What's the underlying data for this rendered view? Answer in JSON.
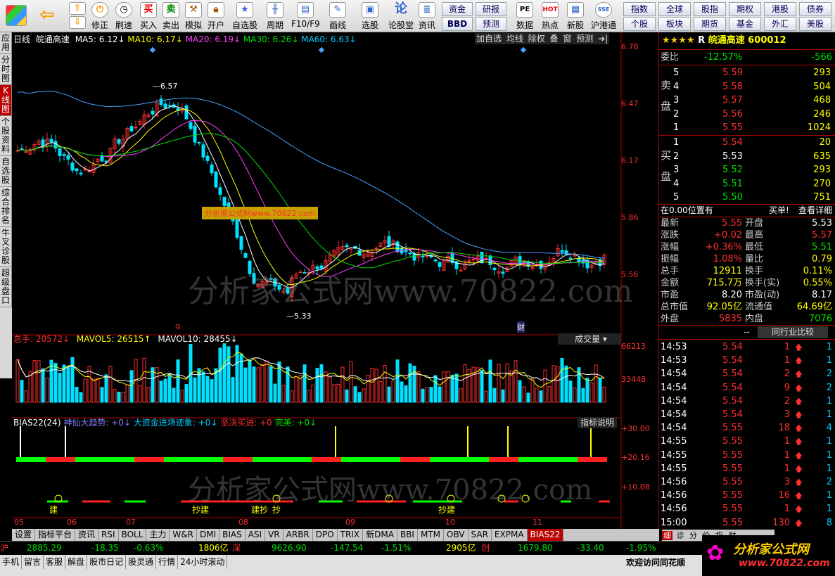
{
  "toolbar": {
    "buttons": [
      "修正",
      "刷速",
      "买入",
      "卖出",
      "模拟",
      "开户",
      "自选股",
      "周期",
      "F10/F9",
      "画线",
      "选股",
      "论股堂",
      "资讯",
      "数据",
      "热点",
      "新股",
      "沪港通"
    ],
    "small1": [
      "资金",
      "BBD"
    ],
    "small2": [
      "研报",
      "预测"
    ],
    "right_top": [
      "指数",
      "全球",
      "股指",
      "期权",
      "港股",
      "债券"
    ],
    "right_bot": [
      "个股",
      "板块",
      "期货",
      "基金",
      "外汇",
      "美股"
    ]
  },
  "left_tabs": [
    "应用",
    "分时图",
    "K线图",
    "个股资料",
    "自选股",
    "综合排名",
    "牛叉诊股",
    "超级盘口"
  ],
  "kline_header": {
    "period": "日线",
    "name": "皖通高速",
    "ma5": "MA5: 6.12↓",
    "ma10": "MA10: 6.17↓",
    "ma20": "MA20: 6.19↓",
    "ma30": "MA30: 6.26↓",
    "ma60": "MA60: 6.63↓",
    "btns": [
      "加自选",
      "均线",
      "除权",
      "叠",
      "窗",
      "预测"
    ]
  },
  "price_axis": [
    "6.78",
    "6.47",
    "6.17",
    "5.86",
    "5.56"
  ],
  "annot": {
    "high": "6.57",
    "low": "5.33",
    "q": "q",
    "cai": "财"
  },
  "vol_header": {
    "a": "总手: 20572↓",
    "b": "MAVOL5: 26515↑",
    "c": "MAVOL10: 28455↓",
    "btn": "成交量"
  },
  "vol_axis": [
    "66213",
    "33448"
  ],
  "bias_header": {
    "a": "BIAS22(24)",
    "b": "神仙大趋势: +0↓",
    "c": "大资金进场迹象: +0↓",
    "d": "坚决买进: +0",
    "e": "完美: +0↓",
    "btn": "指标说明"
  },
  "bias_axis": [
    "+30.00",
    "+20.16",
    "+10.08"
  ],
  "bias_marks": [
    "建",
    "抄建",
    "建抄",
    "抄",
    "抄建"
  ],
  "months": [
    "05",
    "06",
    "07",
    "08",
    "09",
    "10",
    "11"
  ],
  "watermark": "分析家公式网www.70822.com",
  "watermark_small": "分析家公式网www.70822.com",
  "bottom_tabs": [
    "设置",
    "指标平台",
    "资讯",
    "RSI",
    "BOLL",
    "主力",
    "W&R",
    "DMI",
    "BIAS",
    "ASI",
    "VR",
    "ARBR",
    "DPO",
    "TRIX",
    "新DMA",
    "BBI",
    "MTM",
    "OBV",
    "SAR",
    "EXPMA",
    "BIAS22"
  ],
  "stock": {
    "stars": "★★★★",
    "r": "R",
    "name": "皖通高速",
    "code": "600012"
  },
  "weibi": {
    "label": "委比",
    "pct": "-12.57%",
    "val": "-566"
  },
  "sell": [
    [
      "5",
      "5.59",
      "293"
    ],
    [
      "4",
      "5.58",
      "504"
    ],
    [
      "3",
      "5.57",
      "468"
    ],
    [
      "2",
      "5.56",
      "246"
    ],
    [
      "1",
      "5.55",
      "1024"
    ]
  ],
  "buy": [
    [
      "1",
      "5.54",
      "20"
    ],
    [
      "2",
      "5.53",
      "635"
    ],
    [
      "3",
      "5.52",
      "293"
    ],
    [
      "4",
      "5.51",
      "270"
    ],
    [
      "5",
      "5.50",
      "751"
    ]
  ],
  "sell_label": "卖盘",
  "buy_label": "买盘",
  "pos": {
    "a": "在0.00位置有",
    "b": "买单!",
    "c": "查看详细"
  },
  "quote": [
    [
      "最新",
      "5.55",
      "开盘",
      "5.53"
    ],
    [
      "涨跌",
      "+0.02",
      "最高",
      "5.57"
    ],
    [
      "涨幅",
      "+0.36%",
      "最低",
      "5.51"
    ],
    [
      "振幅",
      "1.08%",
      "量比",
      "0.79"
    ],
    [
      "总手",
      "12911",
      "换手",
      "0.11%"
    ],
    [
      "金额",
      "715.7万",
      "换手(实)",
      "0.55%"
    ],
    [
      "市盈",
      "8.20",
      "市盈(动)",
      "8.17"
    ],
    [
      "总市值",
      "92.05亿",
      "流通值",
      "64.69亿"
    ],
    [
      "外盘",
      "5835",
      "内盘",
      "7076"
    ]
  ],
  "peer_btn": "同行业比较",
  "dash": "--",
  "ticks": [
    [
      "14:53",
      "5.54",
      "1",
      "1"
    ],
    [
      "14:53",
      "5.54",
      "1",
      "1"
    ],
    [
      "14:54",
      "5.54",
      "2",
      "2"
    ],
    [
      "14:54",
      "5.54",
      "9",
      "2"
    ],
    [
      "14:54",
      "5.54",
      "2",
      "1"
    ],
    [
      "14:54",
      "5.54",
      "3",
      "1"
    ],
    [
      "14:54",
      "5.55",
      "18",
      "4"
    ],
    [
      "14:55",
      "5.55",
      "1",
      "1"
    ],
    [
      "14:55",
      "5.55",
      "1",
      "1"
    ],
    [
      "14:55",
      "5.55",
      "1",
      "1"
    ],
    [
      "14:56",
      "5.55",
      "3",
      "2"
    ],
    [
      "14:56",
      "5.55",
      "16",
      "1"
    ],
    [
      "14:56",
      "5.55",
      "1",
      "1"
    ],
    [
      "15:00",
      "5.55",
      "130",
      "8"
    ]
  ],
  "rp_tabs": [
    "细",
    "诊",
    "分",
    "价",
    "指",
    "财"
  ],
  "status": {
    "sh": "沪",
    "sh_idx": "2885.29",
    "sh_chg": "-18.35",
    "sh_pct": "-0.63%",
    "sh_amt": "1806亿",
    "sz": "深",
    "sz_idx": "9626.90",
    "sz_chg": "-147.54",
    "sz_pct": "-1.51%",
    "sz_amt": "2905亿",
    "cy": "创",
    "cy_idx": "1679.80",
    "cy_chg": "-33.40",
    "cy_pct": "-1.95%"
  },
  "status2": [
    "手机",
    "留言",
    "客服",
    "解盘",
    "股市日记",
    "股灵通",
    "行情",
    "24小时滚动"
  ],
  "welcome": "欢迎访问同花顺",
  "logo": {
    "name": "分析家公式网",
    "url": "www.70822.com"
  },
  "colors": {
    "up": "#ff3030",
    "down": "#00e0ff",
    "ma5": "#ffffff",
    "ma10": "#ffff00",
    "ma20": "#ff40ff",
    "ma30": "#00e000",
    "ma60": "#4aa0ff"
  }
}
